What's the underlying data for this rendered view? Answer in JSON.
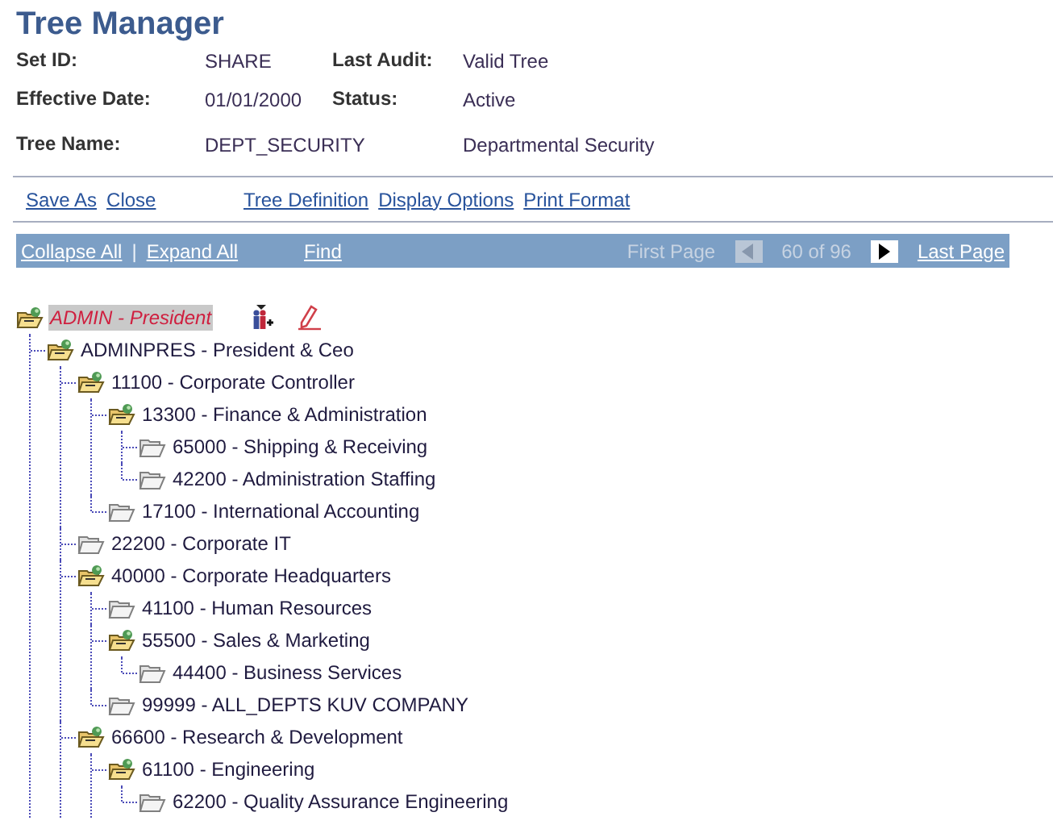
{
  "title": "Tree Manager",
  "fields": [
    {
      "label": "Set ID:",
      "value": "SHARE",
      "label2": "Last Audit:",
      "value2": "Valid Tree"
    },
    {
      "label": "Effective Date:",
      "value": "01/01/2000",
      "label2": "Status:",
      "value2": "Active"
    },
    {
      "label": "Tree Name:",
      "value": "DEPT_SECURITY",
      "value2": "Departmental Security"
    }
  ],
  "actions_left": [
    "Save As",
    "Close"
  ],
  "actions_right": [
    "Tree Definition",
    "Display Options",
    "Print Format"
  ],
  "bar": {
    "links": [
      "Collapse All",
      "Expand All"
    ],
    "separator": "|",
    "find": "Find",
    "pager": {
      "first_page": {
        "label": "First Page",
        "disabled": true
      },
      "previous": {
        "disabled": true
      },
      "position": "60 of 96",
      "next": {
        "disabled": false
      },
      "last_page": {
        "label": "Last Page",
        "disabled": false
      }
    }
  },
  "tree": {
    "label": "ADMIN - President",
    "kind": "branch",
    "selected": true,
    "continues": true,
    "children": [
      {
        "label": "ADMINPRES - President & Ceo",
        "kind": "branch",
        "selected": false,
        "continues": true,
        "children": [
          {
            "label": "11100 - Corporate Controller",
            "kind": "branch",
            "selected": false,
            "children": [
              {
                "label": "13300 - Finance & Administration",
                "kind": "branch",
                "selected": false,
                "children": [
                  {
                    "label": "65000 - Shipping & Receiving",
                    "kind": "leaf",
                    "selected": false
                  },
                  {
                    "label": "42200 - Administration Staffing",
                    "kind": "leaf",
                    "selected": false
                  }
                ]
              },
              {
                "label": "17100 - International Accounting",
                "kind": "leaf",
                "selected": false
              }
            ]
          },
          {
            "label": "22200 - Corporate IT",
            "kind": "leaf",
            "selected": false
          },
          {
            "label": "40000 - Corporate Headquarters",
            "kind": "branch",
            "selected": false,
            "children": [
              {
                "label": "41100 - Human Resources",
                "kind": "leaf",
                "selected": false
              },
              {
                "label": "55500 - Sales & Marketing",
                "kind": "branch",
                "selected": false,
                "children": [
                  {
                    "label": "44400 - Business Services",
                    "kind": "leaf",
                    "selected": false
                  }
                ]
              },
              {
                "label": "99999 - ALL_DEPTS KUV COMPANY",
                "kind": "leaf",
                "selected": false
              }
            ]
          },
          {
            "label": "66600 - Research & Development",
            "kind": "branch",
            "selected": false,
            "continues": true,
            "children": [
              {
                "label": "61100 - Engineering",
                "kind": "branch",
                "selected": false,
                "children": [
                  {
                    "label": "62200 - Quality Assurance Engineering",
                    "kind": "leaf",
                    "selected": false
                  }
                ]
              }
            ]
          }
        ]
      }
    ]
  }
}
